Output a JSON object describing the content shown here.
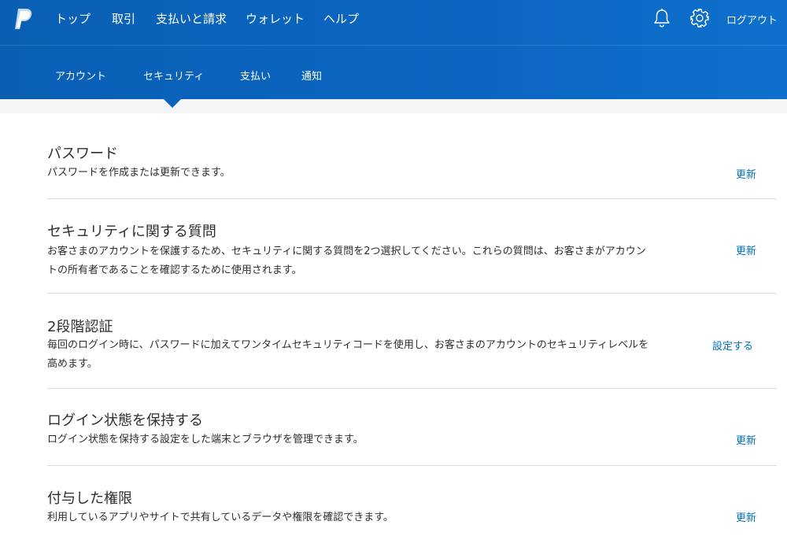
{
  "header": {
    "nav": [
      "トップ",
      "取引",
      "支払いと請求",
      "ウォレット",
      "ヘルプ"
    ],
    "logout": "ログアウト",
    "subnav": [
      "アカウント",
      "セキュリティ",
      "支払い",
      "通知"
    ],
    "active_subnav": "セキュリティ"
  },
  "sections": [
    {
      "title": "パスワード",
      "desc": "パスワードを作成または更新できます。",
      "action": "更新"
    },
    {
      "title": "セキュリティに関する質問",
      "desc": "お客さまのアカウントを保護するため、セキュリティに関する質問を2つ選択してください。これらの質問は、お客さまがアカウントの所有者であることを確認するために使用されます。",
      "action": "更新"
    },
    {
      "title": "2段階認証",
      "desc": "毎回のログイン時に、パスワードに加えてワンタイムセキュリティコードを使用し、お客さまのアカウントのセキュリティレベルを高めます。",
      "action": "設定する"
    },
    {
      "title": "ログイン状態を保持する",
      "desc": "ログイン状態を保持する設定をした端末とブラウザを管理できます。",
      "action": "更新"
    },
    {
      "title": "付与した権限",
      "desc": "利用しているアプリやサイトで共有しているデータや権限を確認できます。",
      "action": "更新"
    }
  ],
  "icons": {
    "logo": "paypal-logo-icon",
    "bell": "bell-icon",
    "gear": "gear-icon"
  },
  "colors": {
    "header_bg": "#0b66c1",
    "link": "#0070ba",
    "text": "#2c2e2f"
  }
}
